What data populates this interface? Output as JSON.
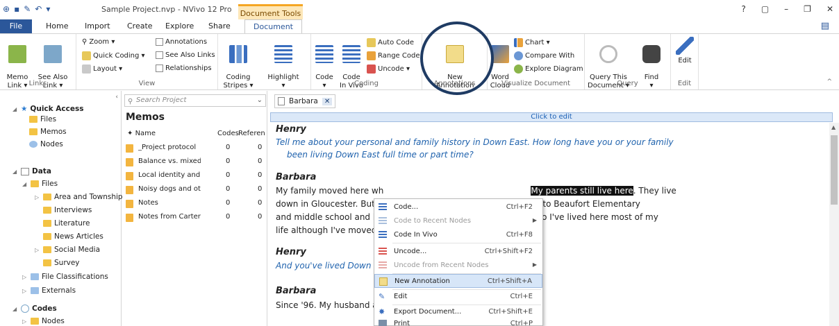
{
  "window": {
    "title": "Sample Project.nvp - NVivo 12 Pro",
    "context_tab_header": "Document Tools",
    "controls": [
      "?",
      "▢",
      "–",
      "❐",
      "✕"
    ]
  },
  "tabs": {
    "file": "File",
    "items": [
      "Home",
      "Import",
      "Create",
      "Explore",
      "Share"
    ],
    "document": "Document"
  },
  "ribbon": {
    "links": {
      "group": "Links",
      "memo_link": "Memo\nLink ▾",
      "see_also_link": "See Also\nLink ▾",
      "zoom": "Zoom ▾",
      "quick_coding": "Quick Coding ▾",
      "layout": "Layout ▾"
    },
    "view": {
      "group": "View",
      "annotations": "Annotations",
      "see_also_links": "See Also Links",
      "relationships": "Relationships"
    },
    "coding_stripes": "Coding\nStripes ▾",
    "highlight": "Highlight\n▾",
    "coding": {
      "group": "Coding",
      "code": "Code\n▾",
      "code_in_vivo": "Code\nIn Vivo",
      "auto_code": "Auto Code",
      "range_code": "Range Code",
      "uncode": "Uncode ▾"
    },
    "annotations": {
      "group": "Annotations",
      "new_annotation": "New\nAnnotation"
    },
    "visualize": {
      "group": "Visualize Document",
      "word_cloud": "Word\nCloud",
      "chart": "Chart ▾",
      "compare_with": "Compare With",
      "explore_diagram": "Explore Diagram"
    },
    "query": {
      "group": "Query",
      "query_this_document": "Query This\nDocument ▾",
      "find": "Find\n▾"
    },
    "edit": {
      "group": "Edit",
      "edit": "Edit"
    }
  },
  "navigation": {
    "quick_access": "Quick Access",
    "qa_items": [
      "Files",
      "Memos",
      "Nodes"
    ],
    "data": "Data",
    "files": "Files",
    "file_folders": [
      "Area and Township",
      "Interviews",
      "Literature",
      "News Articles",
      "Social Media",
      "Survey"
    ],
    "file_classifications": "File Classifications",
    "externals": "Externals",
    "codes": "Codes",
    "nodes": "Nodes"
  },
  "list_view": {
    "search_placeholder": "Search Project",
    "title": "Memos",
    "columns": {
      "name": "Name",
      "codes": "Codes",
      "references": "Referen"
    },
    "rows": [
      {
        "name": "_Project protocol",
        "codes": "0",
        "references": "0"
      },
      {
        "name": "Balance vs. mixed f",
        "codes": "0",
        "references": "0"
      },
      {
        "name": "Local identity and",
        "codes": "0",
        "references": "0"
      },
      {
        "name": "Noisy dogs and ot",
        "codes": "0",
        "references": "0"
      },
      {
        "name": "Notes",
        "codes": "0",
        "references": "0"
      },
      {
        "name": "Notes from Carter",
        "codes": "0",
        "references": "0"
      }
    ]
  },
  "detail": {
    "tab_name": "Barbara",
    "click_to_edit": "Click to edit",
    "speaker1": "Henry",
    "q1_line1": "Tell me about your personal and family history in Down East. How long have you or your family",
    "q1_line2": "been living Down East full time or part time?",
    "speaker2": "Barbara",
    "a1_line1_pre": "My family moved here wh",
    "a1_line1_sel": "My parents still live here",
    "a1_line1_post": ". They live",
    "a1_line2_pre": "down in Gloucester. But",
    "a1_line2_post": "t to Beaufort Elementary",
    "a1_line3_pre": "and middle school and h",
    "a1_line3_post": "So I've lived here most of my",
    "a1_line4_pre": "life although I've moved",
    "speaker3": "Henry",
    "q2_pre": "And you've lived Down E",
    "speaker4": "Barbara",
    "a2_pre": "Since '96. My husband a"
  },
  "context_menu": {
    "items": [
      {
        "label": "Code...",
        "shortcut": "Ctrl+F2",
        "icon": "code-icon"
      },
      {
        "label": "Code to Recent Nodes",
        "shortcut": "",
        "icon": "code-recent-icon"
      },
      {
        "label": "Code In Vivo",
        "shortcut": "Ctrl+F8",
        "icon": "code-in-vivo-icon"
      },
      {
        "label": "Uncode...",
        "shortcut": "Ctrl+Shift+F2",
        "icon": "uncode-icon"
      },
      {
        "label": "Uncode from Recent Nodes",
        "shortcut": "",
        "icon": "uncode-recent-icon"
      },
      {
        "label": "New Annotation",
        "shortcut": "Ctrl+Shift+A",
        "icon": "new-annotation-icon"
      },
      {
        "label": "Edit",
        "shortcut": "Ctrl+E",
        "icon": "pencil-icon"
      },
      {
        "label": "Export Document...",
        "shortcut": "Ctrl+Shift+E",
        "icon": "export-icon"
      },
      {
        "label": "Print",
        "shortcut": "Ctrl+P",
        "icon": "print-icon"
      }
    ]
  },
  "colors": {
    "accent": "#2b579a",
    "highlight_circle": "#1f3b63",
    "menu_hover": "#d7e6f8",
    "question_text": "#1f62ad"
  }
}
